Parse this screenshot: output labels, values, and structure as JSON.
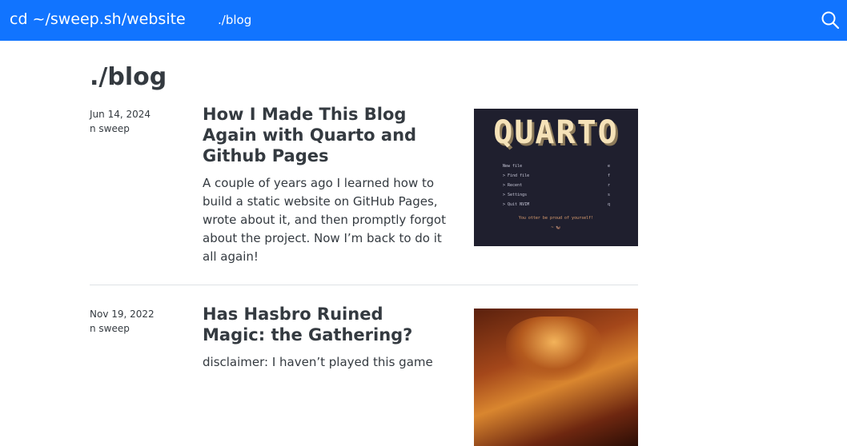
{
  "navbar": {
    "brand": "cd ~/sweep.sh/website",
    "link": "./blog",
    "search_icon": "search-icon",
    "color": "#1174ff"
  },
  "page": {
    "title": "./blog"
  },
  "posts": [
    {
      "date": "Jun 14, 2024",
      "author": "n sweep",
      "title": "How I Made This Blog Again with Quarto and Github Pages",
      "description": "A couple of years ago I learned how to build a static website on GitHub Pages, wrote about it, and then promptly forgot about the project. Now I’m back to do it all again!",
      "thumbnail": {
        "logo": "QUARTO",
        "menu": [
          {
            "label": "New file",
            "key": "e"
          },
          {
            "label": "> Find file",
            "key": "f"
          },
          {
            "label": "> Recent",
            "key": "r"
          },
          {
            "label": "> Settings",
            "key": "s"
          },
          {
            "label": "> Quit NVIM",
            "key": "q"
          }
        ],
        "footer": "You otter be proud of yourself!",
        "footer2": "~ 🦦"
      }
    },
    {
      "date": "Nov 19, 2022",
      "author": "n sweep",
      "title": "Has Hasbro Ruined Magic: the Gathering?",
      "description": "disclaimer: I haven’t played this game"
    }
  ]
}
